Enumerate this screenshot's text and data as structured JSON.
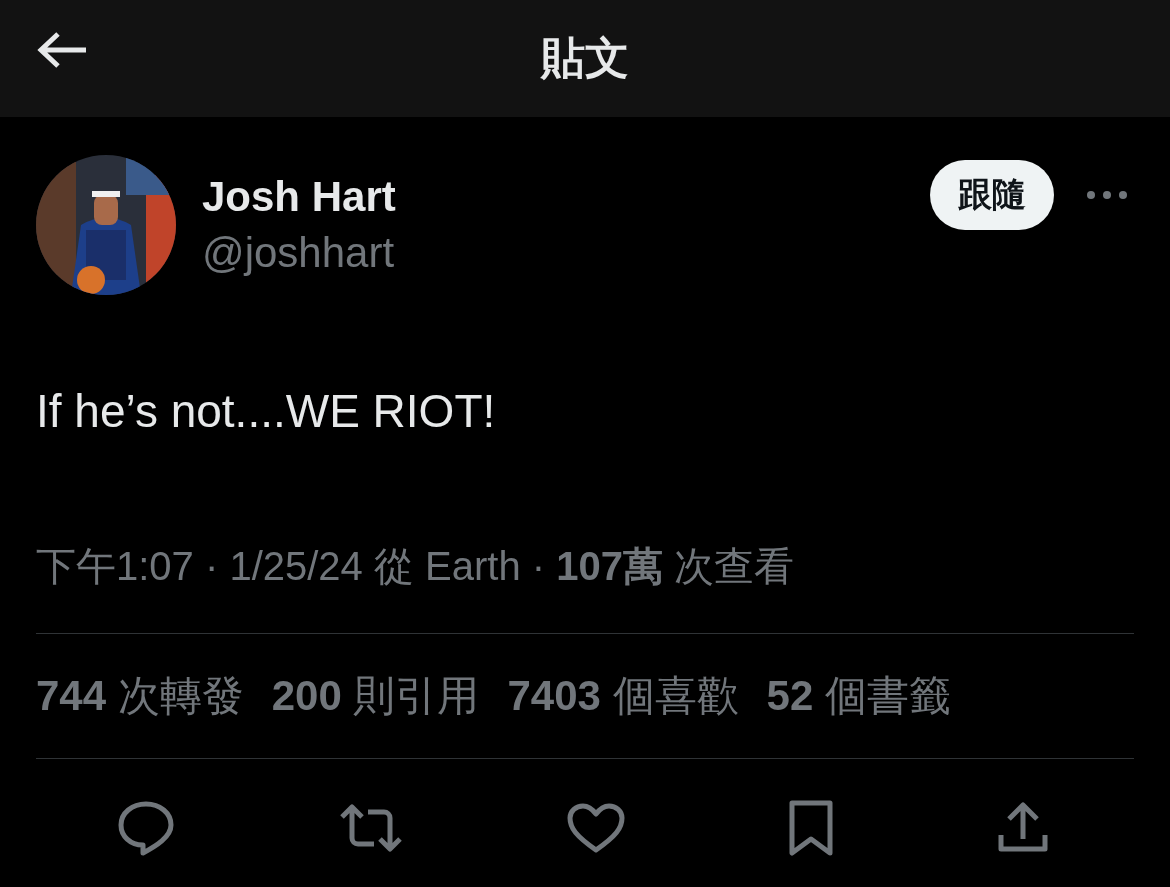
{
  "header": {
    "title": "貼文"
  },
  "author": {
    "name": "Josh Hart",
    "handle": "@joshhart"
  },
  "follow_button": "跟隨",
  "tweet": {
    "text": "If he’s not....WE RIOT!",
    "meta": "下午1:07 · 1/25/24 從 Earth · **107萬** 次查看"
  },
  "stats": [
    {
      "text": "**744** 次轉發"
    },
    {
      "text": "**200** 則引用"
    },
    {
      "text": "**7403** 個喜歡"
    },
    {
      "text": "**52** 個書籤"
    }
  ],
  "actions": [
    {
      "kind": "reply"
    },
    {
      "kind": "repost"
    },
    {
      "kind": "like"
    },
    {
      "kind": "bookmark"
    },
    {
      "kind": "share"
    }
  ]
}
